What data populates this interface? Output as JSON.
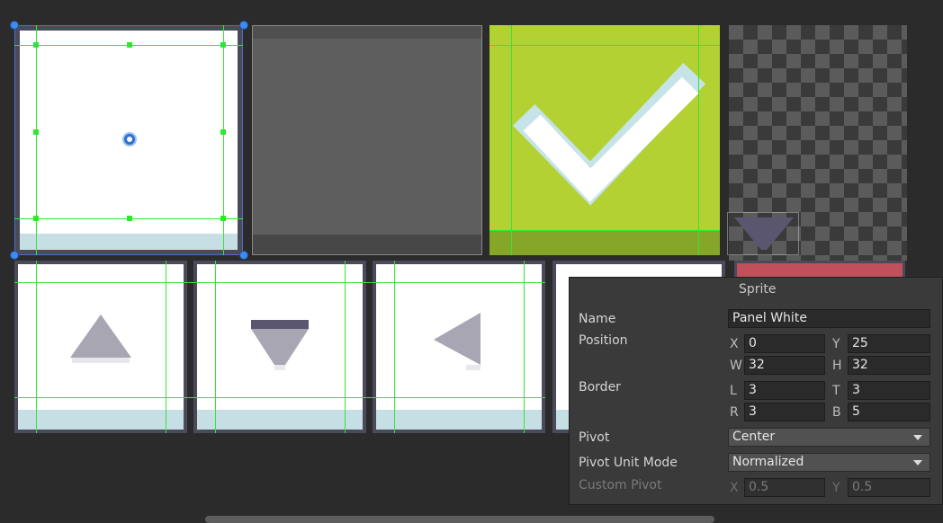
{
  "inspector": {
    "title": "Sprite",
    "name_label": "Name",
    "name_value": "Panel White",
    "position_label": "Position",
    "pos_x_label": "X",
    "pos_x": "0",
    "pos_y_label": "Y",
    "pos_y": "25",
    "pos_w_label": "W",
    "pos_w": "32",
    "pos_h_label": "H",
    "pos_h": "32",
    "border_label": "Border",
    "border_l_label": "L",
    "border_l": "3",
    "border_t_label": "T",
    "border_t": "3",
    "border_r_label": "R",
    "border_r": "3",
    "border_b_label": "B",
    "border_b": "5",
    "pivot_label": "Pivot",
    "pivot_value": "Center",
    "pivot_unit_label": "Pivot Unit Mode",
    "pivot_unit_value": "Normalized",
    "custom_pivot_label": "Custom Pivot",
    "custom_x_label": "X",
    "custom_x": "0.5",
    "custom_y_label": "Y",
    "custom_y": "0.5"
  },
  "colors": {
    "background": "#2b2b2b",
    "panel_white": "#ffffff",
    "panel_strip": "#c6dfe5",
    "check_green": "#b4d133",
    "check_dark_green": "#86a62a",
    "arrow_gray": "#a9a6b4",
    "selection_blue": "#3d8cf0",
    "slice_green": "#35e535",
    "red_panel": "#c0505a",
    "purple_arrow": "#5a5670"
  },
  "icons": [
    "checkmark-icon",
    "arrow-up-icon",
    "arrow-down-icon",
    "arrow-left-icon",
    "arrow-right-icon",
    "pivot-icon",
    "dropdown-caret-icon"
  ]
}
